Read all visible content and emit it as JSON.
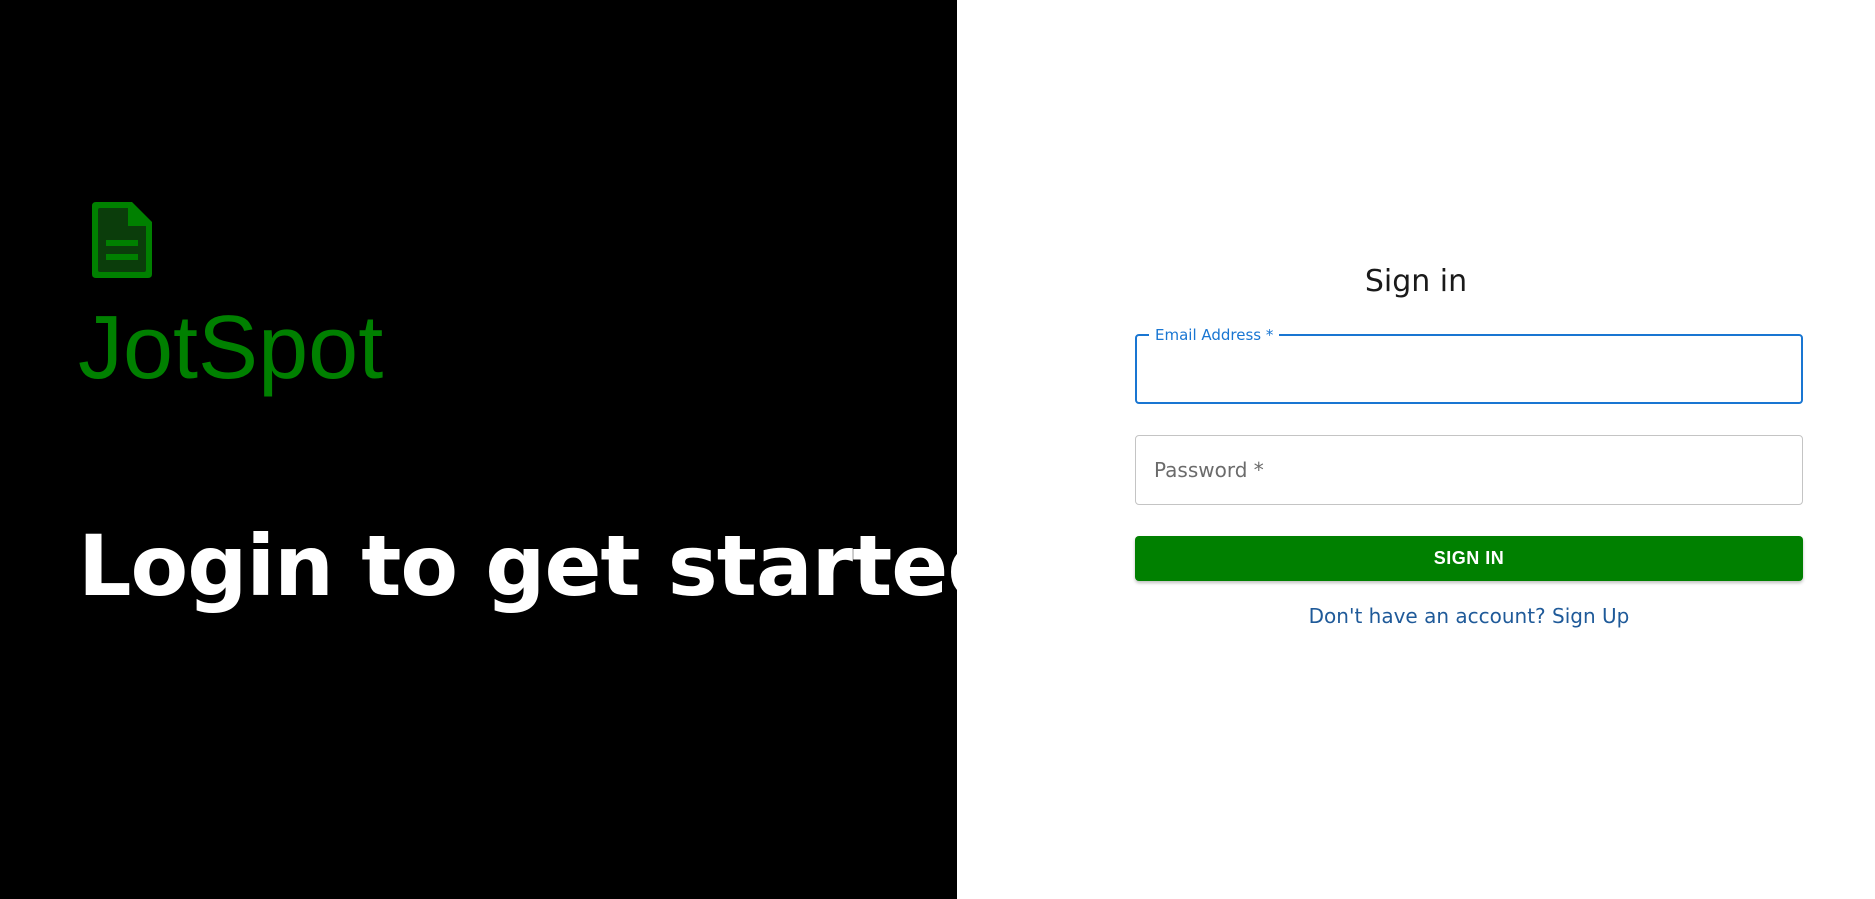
{
  "brand": {
    "name": "JotSpot",
    "logo_icon": "document-icon",
    "color": "#008000"
  },
  "hero": {
    "tagline": "Login to get started"
  },
  "signin": {
    "title": "Sign in",
    "email": {
      "label": "Email Address *",
      "value": ""
    },
    "password": {
      "placeholder": "Password *",
      "value": ""
    },
    "submit_label": "SIGN IN",
    "signup_link": "Don't have an account? Sign Up"
  },
  "colors": {
    "left_background": "#000000",
    "accent_green": "#008000",
    "focus_blue": "#1976d2",
    "link_blue": "#1f5a99"
  }
}
